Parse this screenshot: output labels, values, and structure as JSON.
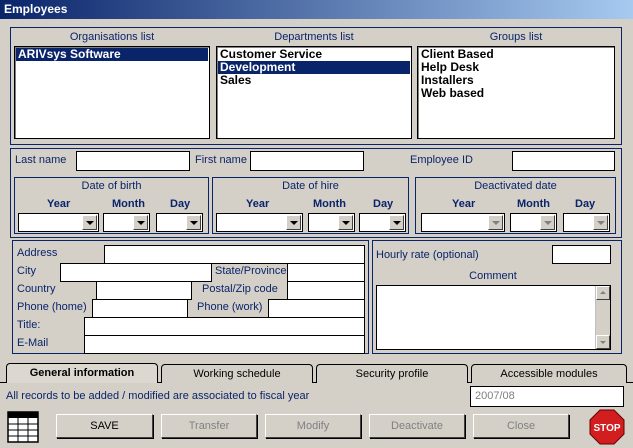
{
  "window": {
    "title": "Employees"
  },
  "lists": {
    "organisations": {
      "label": "Organisations list",
      "items": [
        "ARIVsys Software"
      ],
      "selected": 0
    },
    "departments": {
      "label": "Departments list",
      "items": [
        "Customer Service",
        "Development",
        "Sales"
      ],
      "selected": 1
    },
    "groups": {
      "label": "Groups list",
      "items": [
        "Client Based",
        "Help Desk",
        "Installers",
        "Web based"
      ]
    }
  },
  "identity": {
    "last_name": {
      "label": "Last name",
      "value": ""
    },
    "first_name": {
      "label": "First name",
      "value": ""
    },
    "employee_id": {
      "label": "Employee ID",
      "value": ""
    }
  },
  "dates": {
    "birth": {
      "title": "Date of birth"
    },
    "hire": {
      "title": "Date of hire"
    },
    "deactivated": {
      "title": "Deactivated date"
    },
    "year_label": "Year",
    "month_label": "Month",
    "day_label": "Day"
  },
  "address": {
    "address_label": "Address",
    "city_label": "City",
    "state_label": "State/Province",
    "country_label": "Country",
    "postal_label": "Postal/Zip code",
    "phone_home_label": "Phone (home)",
    "phone_work_label": "Phone (work)",
    "title_label": "Title:",
    "email_label": "E-Mail"
  },
  "rate": {
    "hourly_label": "Hourly rate (optional)",
    "comment_label": "Comment"
  },
  "tabs": [
    "General information",
    "Working schedule",
    "Security profile",
    "Accessible modules"
  ],
  "active_tab": 0,
  "status": {
    "message": "All records to be added / modified are associated to fiscal year",
    "fiscal_year": "2007/08"
  },
  "buttons": {
    "save": "SAVE",
    "transfer": "Transfer",
    "modify": "Modify",
    "deactivate": "Deactivate",
    "close": "Close",
    "stop": "STOP"
  },
  "icons": {
    "grid": "grid-icon",
    "stop": "stop-sign-icon"
  },
  "colors": {
    "label_text": "#0a246a",
    "selection": "#0a246a",
    "stop_red": "#d21e1e"
  }
}
